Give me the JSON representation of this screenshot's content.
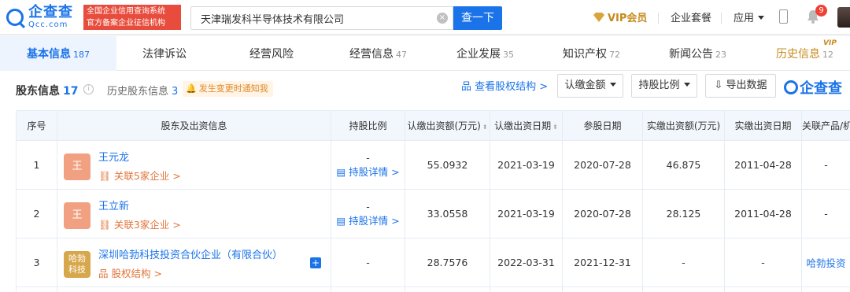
{
  "header": {
    "logo_cn": "企查查",
    "logo_en": "Qcc.com",
    "tagline_1": "全国企业信用查询系统",
    "tagline_2": "官方备案企业征信机构",
    "search_value": "天津瑞发科半导体技术有限公司",
    "search_button": "查一下",
    "vip": "VIP会员",
    "enterprise_package": "企业套餐",
    "apps": "应用",
    "notification_count": "9"
  },
  "nav": {
    "tabs": [
      {
        "label": "基本信息",
        "count": "187"
      },
      {
        "label": "法律诉讼",
        "count": ""
      },
      {
        "label": "经营风险",
        "count": ""
      },
      {
        "label": "经营信息",
        "count": "47"
      },
      {
        "label": "企业发展",
        "count": "35"
      },
      {
        "label": "知识产权",
        "count": "72"
      },
      {
        "label": "新闻公告",
        "count": "23"
      },
      {
        "label": "历史信息",
        "count": "12"
      }
    ],
    "vip_tag": "VIP"
  },
  "section": {
    "title": "股东信息",
    "count": "17",
    "history_label": "历史股东信息",
    "history_count": "3",
    "notify": "发生变更时通知我",
    "view_structure": "查看股权结构 >",
    "btn_amount": "认缴金额",
    "btn_ratio": "持股比例",
    "btn_export": "导出数据",
    "brand": "企查查"
  },
  "table": {
    "headers": [
      "序号",
      "股东及出资信息",
      "持股比例",
      "认缴出资额(万元)",
      "认缴出资日期",
      "参股日期",
      "实缴出资额(万元)",
      "实缴出资日期",
      "关联产品/机构"
    ],
    "rows": [
      {
        "no": "1",
        "avatar": "王",
        "name": "王元龙",
        "sub": "关联5家企业 >",
        "pct_top": "-",
        "pct_link": "持股详情 >",
        "sub_amt": "55.0932",
        "sub_date": "2021-03-19",
        "join_date": "2020-07-28",
        "paid_amt": "46.875",
        "paid_date": "2011-04-28",
        "related": "-"
      },
      {
        "no": "2",
        "avatar": "王",
        "name": "王立新",
        "sub": "关联3家企业 >",
        "pct_top": "-",
        "pct_link": "持股详情 >",
        "sub_amt": "33.0558",
        "sub_date": "2021-03-19",
        "join_date": "2020-07-28",
        "paid_amt": "28.125",
        "paid_date": "2011-04-28",
        "related": "-"
      },
      {
        "no": "3",
        "avatar_1": "哈勃",
        "avatar_2": "科技",
        "name": "深圳哈勃科技投资合伙企业（有限合伙）",
        "sub": "股权结构 >",
        "pct": "-",
        "sub_amt": "28.7576",
        "sub_date": "2022-03-31",
        "join_date": "2021-12-31",
        "paid_amt": "-",
        "paid_date": "-",
        "related": "哈勃投资"
      }
    ]
  }
}
